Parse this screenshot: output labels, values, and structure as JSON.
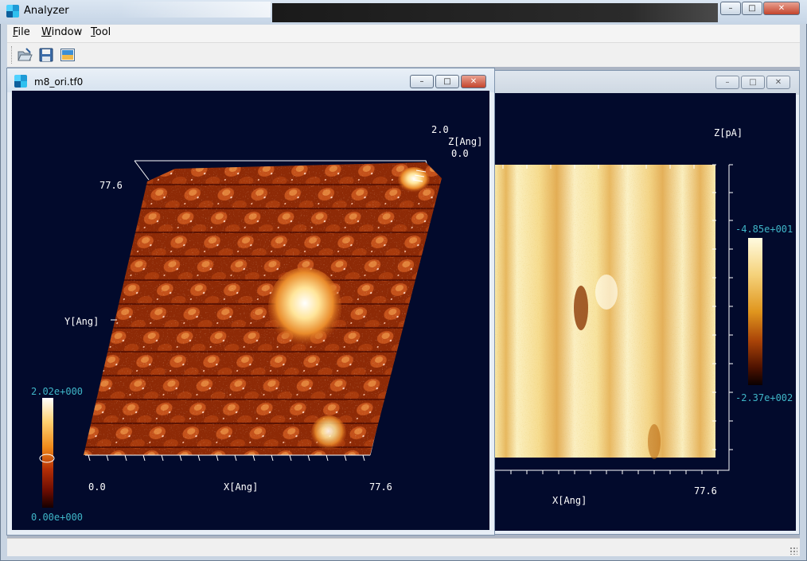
{
  "app": {
    "title": "Analyzer",
    "icon": "analyzer-app-icon",
    "caption_buttons": {
      "minimize": "minimize-icon",
      "maximize": "maximize-icon",
      "close": "close-icon"
    }
  },
  "menu": {
    "items": [
      {
        "label": "File",
        "mnemonic": "F",
        "rest": "ile"
      },
      {
        "label": "Window",
        "mnemonic": "W",
        "rest": "indow"
      },
      {
        "label": "Tool",
        "mnemonic": "T",
        "rest": "ool"
      }
    ]
  },
  "toolbar": {
    "buttons": [
      {
        "icon": "open-folder-icon"
      },
      {
        "icon": "save-disk-icon"
      },
      {
        "icon": "image-view-icon"
      }
    ]
  },
  "window_3d": {
    "title": "m8_ori.tf0",
    "z_max": "2.0",
    "z_min": "0.0",
    "z_label": "Z[Ang]",
    "y_max": "77.6",
    "y_label": "Y[Ang]",
    "x_min": "0.0",
    "x_label": "X[Ang]",
    "x_max": "77.6",
    "colorbar_max": "2.02e+000",
    "colorbar_min": "0.00e+000",
    "colormap": [
      "#ffffff",
      "#ffd070",
      "#f08a1a",
      "#b42e06",
      "#6a0c02",
      "#150000"
    ]
  },
  "window_2d": {
    "z_label": "Z[pA]",
    "colorbar_top": "-4.85e+001",
    "colorbar_bottom": "-2.37e+002",
    "x_label": "X[Ang]",
    "x_max": "77.6",
    "colormap": [
      "#fffbe0",
      "#f5d27a",
      "#e0961e",
      "#a94308",
      "#4e1200",
      "#0a0000"
    ]
  }
}
